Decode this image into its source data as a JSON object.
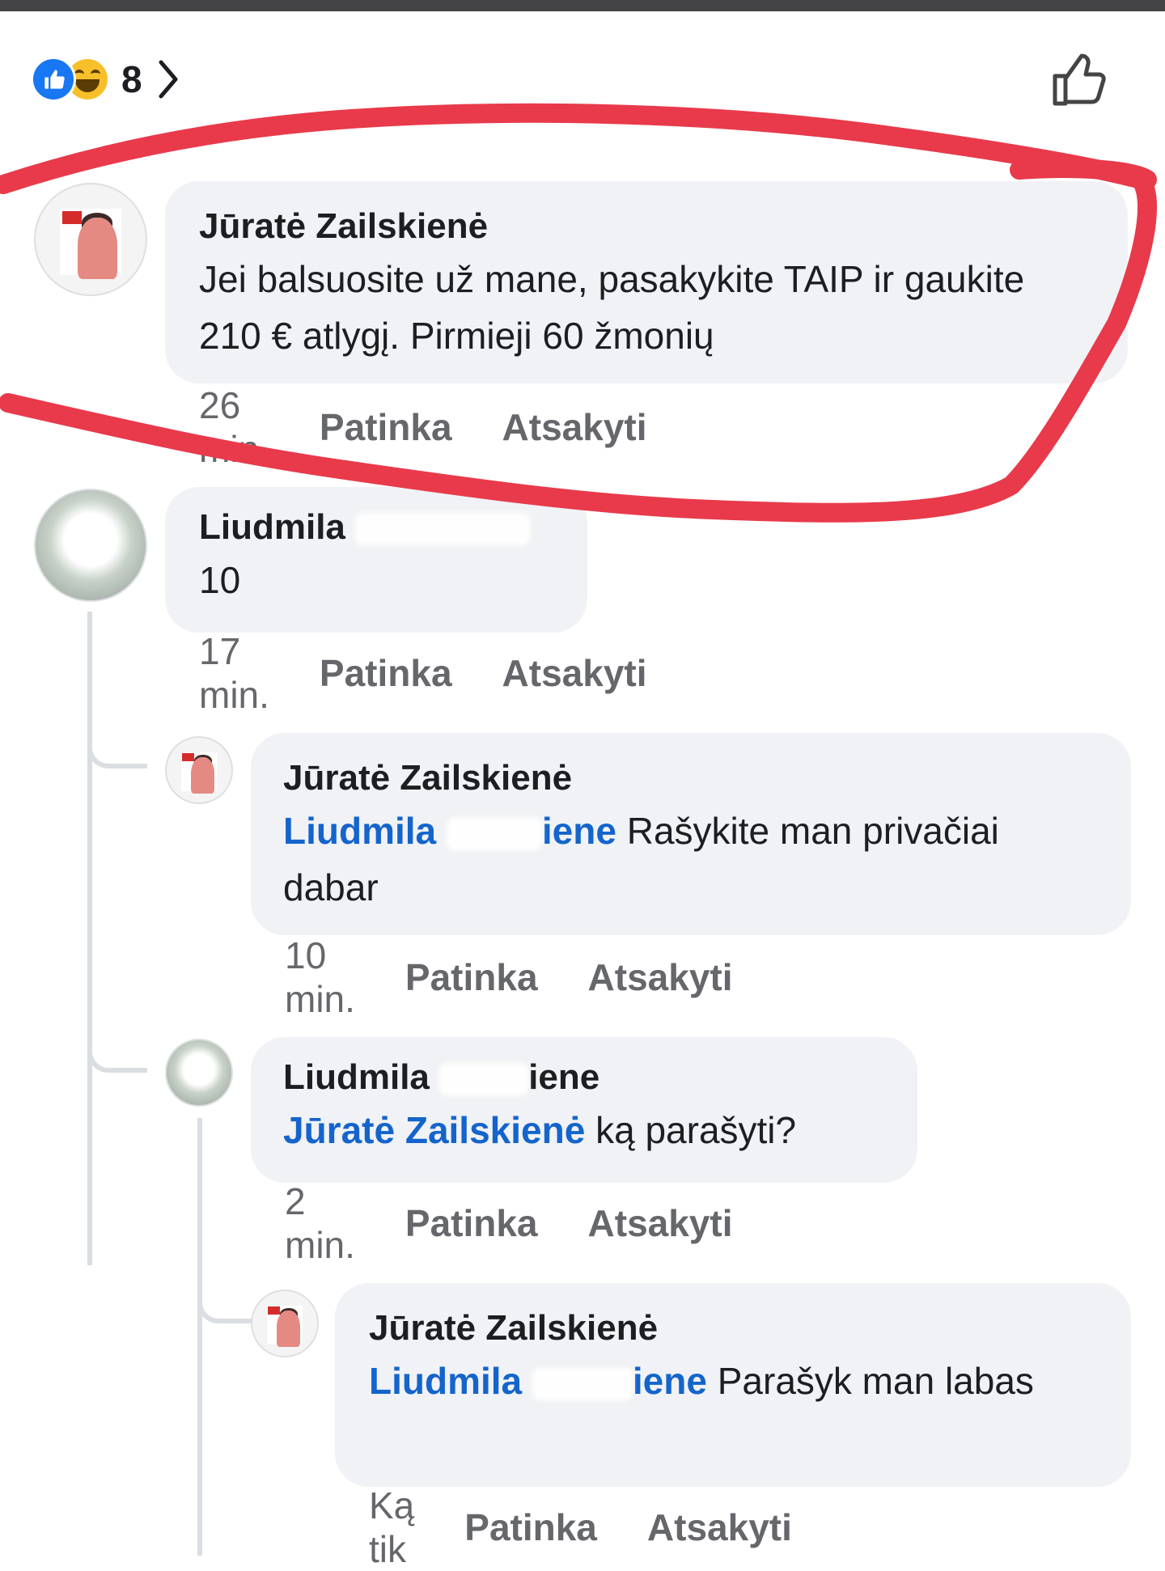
{
  "reactions": {
    "count": "8",
    "types": [
      "like-icon",
      "haha-icon"
    ]
  },
  "comments": [
    {
      "author": "Jūratė Zailskienė",
      "text": "Jei balsuosite už mane, pasakykite TAIP ir gaukite 210 € atlygį. Pirmieji 60 žmonių",
      "time": "26 min.",
      "like_label": "Patinka",
      "reply_label": "Atsakyti"
    },
    {
      "author": "Liudmila",
      "text": "10",
      "time": "17 min.",
      "like_label": "Patinka",
      "reply_label": "Atsakyti"
    },
    {
      "author": "Jūratė Zailskienė",
      "mention": "Liudmila",
      "mention_suffix": "iene",
      "text": "Rašykite man privačiai dabar",
      "time": "10 min.",
      "like_label": "Patinka",
      "reply_label": "Atsakyti"
    },
    {
      "author": "Liudmila",
      "author_suffix": "iene",
      "mention": "Jūratė Zailskienė",
      "text": "ką parašyti?",
      "time": "2 min.",
      "like_label": "Patinka",
      "reply_label": "Atsakyti"
    },
    {
      "author": "Jūratė Zailskienė",
      "mention": "Liudmila",
      "mention_suffix": "iene",
      "text": "Parašyk man labas",
      "time": "Ką tik",
      "like_label": "Patinka",
      "reply_label": "Atsakyti"
    }
  ],
  "colors": {
    "mention": "#1464cc",
    "bubble": "#f0f2f5",
    "highlight": "#e83a4b",
    "like_blue": "#1877f2"
  }
}
